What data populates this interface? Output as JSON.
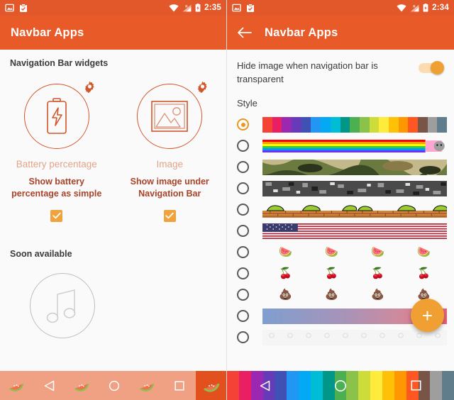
{
  "theme": {
    "appbar": "#e85a27",
    "statusbar": "#e2582a",
    "accent_orange": "#f0a033",
    "outline_orange": "#d1562a",
    "desc_text": "#a8432a",
    "title_text": "#e0a58a",
    "background": "#fafafa",
    "left_navbar": "#f0a184",
    "left_navbar_end": "#e2511d"
  },
  "left_screen": {
    "status": {
      "time": "2:35",
      "icons": [
        "image-notification-icon",
        "clipboard-check-notification-icon"
      ],
      "system_icons": [
        "wifi-icon",
        "signal-roaming-icon",
        "battery-charging-icon"
      ]
    },
    "appbar": {
      "title": "Navbar Apps"
    },
    "section_title": "Navigation Bar widgets",
    "widgets": [
      {
        "icon": "battery-icon",
        "gear": "gear-icon",
        "title": "Battery percentage",
        "description": "Show battery percentage as simple",
        "checked": true
      },
      {
        "icon": "image-icon",
        "gear": "gear-icon",
        "title": "Image",
        "description": "Show image under Navigation Bar",
        "checked": true
      }
    ],
    "soon_title": "Soon available",
    "soon_items": [
      {
        "icon": "music-note-icon"
      }
    ],
    "navbar": {
      "items": [
        "watermelon-emoji",
        "back-triangle-icon",
        "watermelon-emoji",
        "home-circle-icon",
        "watermelon-emoji",
        "recents-square-icon"
      ],
      "end_item": "watermelon-emoji"
    }
  },
  "right_screen": {
    "status": {
      "time": "2:34",
      "icons": [
        "image-notification-icon",
        "clipboard-check-notification-icon"
      ],
      "system_icons": [
        "wifi-icon",
        "signal-roaming-icon",
        "battery-charging-icon"
      ]
    },
    "appbar": {
      "back": "back-arrow-icon",
      "title": "Navbar Apps"
    },
    "setting": {
      "label": "Hide image when navigation bar is transparent",
      "toggle_on": true
    },
    "style_label": "Style",
    "styles": [
      {
        "name": "material-color-stripes",
        "selected": true,
        "kind": "stripes",
        "colors": [
          "#f44336",
          "#e91e63",
          "#9c27b0",
          "#673ab7",
          "#3f51b5",
          "#2196f3",
          "#03a9f4",
          "#00bcd4",
          "#009688",
          "#4caf50",
          "#8bc34a",
          "#cddc39",
          "#ffeb3b",
          "#ffc107",
          "#ff9800",
          "#ff5722",
          "#795548",
          "#9e9e9e",
          "#607d8b"
        ]
      },
      {
        "name": "nyan-cat-rainbow",
        "selected": false,
        "kind": "rainbow",
        "colors": [
          "#ff0000",
          "#ff9900",
          "#ffff00",
          "#33cc33",
          "#0099ff",
          "#6633ff"
        ]
      },
      {
        "name": "green-camouflage",
        "selected": false,
        "kind": "camo",
        "colors": [
          "#4a5c2a",
          "#7a8a4a",
          "#c4b98a",
          "#3a4a24",
          "#6b5a3a",
          "#2b331c"
        ]
      },
      {
        "name": "gray-digital-camouflage",
        "selected": false,
        "kind": "camo",
        "colors": [
          "#555555",
          "#888888",
          "#bbbbbb",
          "#333333",
          "#dddddd",
          "#6e6e6e"
        ]
      },
      {
        "name": "mario-grass-brick",
        "selected": false,
        "kind": "mario",
        "colors": [
          "#9acd32",
          "#6b8e23",
          "#d2833c",
          "#a0522d"
        ]
      },
      {
        "name": "usa-flag",
        "selected": false,
        "kind": "flag",
        "colors": [
          "#b22234",
          "#ffffff",
          "#3c3b6e"
        ]
      },
      {
        "name": "watermelon-emoji",
        "selected": false,
        "kind": "emoji",
        "glyph": "🍉"
      },
      {
        "name": "cherries-emoji",
        "selected": false,
        "kind": "emoji",
        "glyph": "🍒"
      },
      {
        "name": "poop-emoji",
        "selected": false,
        "kind": "emoji",
        "glyph": "💩"
      },
      {
        "name": "blue-red-gradient",
        "selected": false,
        "kind": "gradient",
        "colors": [
          "#7f9fd0",
          "#c8889f",
          "#e8607a"
        ]
      },
      {
        "name": "polka-dot-stripes",
        "selected": false,
        "kind": "dots",
        "colors": [
          "#f5f5f5"
        ]
      }
    ],
    "fab": {
      "label": "+",
      "name": "add-style-fab"
    },
    "navbar": {
      "items": [
        "back-triangle-icon",
        "home-circle-icon",
        "recents-square-icon"
      ],
      "colors": [
        "#f44336",
        "#e91e63",
        "#9c27b0",
        "#673ab7",
        "#3f51b5",
        "#2196f3",
        "#03a9f4",
        "#00bcd4",
        "#009688",
        "#4caf50",
        "#8bc34a",
        "#cddc39",
        "#ffeb3b",
        "#ffc107",
        "#ff9800",
        "#ff5722",
        "#795548",
        "#9e9e9e",
        "#607d8b"
      ]
    }
  }
}
